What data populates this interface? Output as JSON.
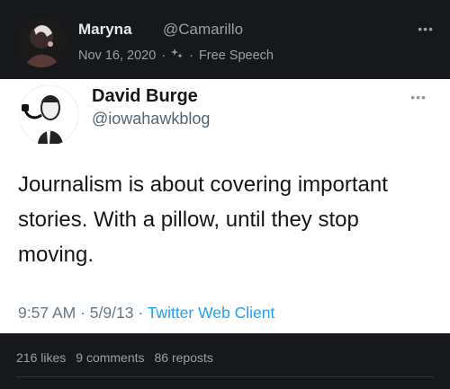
{
  "post": {
    "author_name": "Maryna",
    "author_handle": "@Camarillo",
    "date": "Nov 16, 2020",
    "flair_icon": "sparkle-icon",
    "community": "Free Speech",
    "more_icon": "more-dots-icon"
  },
  "tweet": {
    "name": "David Burge",
    "handle": "@iowahawkblog",
    "text": "Journalism is about covering important stories. With a pillow, until they stop moving.",
    "time": "9:57 AM",
    "date": "5/9/13",
    "source": "Twitter Web Client",
    "source_color": "#1da1f2"
  },
  "engagement": {
    "likes": "216 likes",
    "comments": "9 comments",
    "reposts": "86 reposts"
  }
}
